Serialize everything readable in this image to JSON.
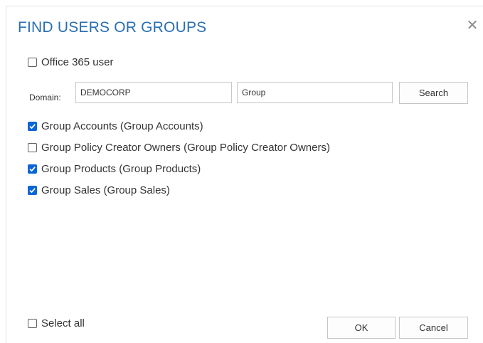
{
  "dialog": {
    "title": "FIND USERS OR GROUPS",
    "close_icon": "close-icon"
  },
  "office365": {
    "label": "Office 365 user",
    "checked": false
  },
  "domain": {
    "label": "Domain:",
    "value": "DEMOCORP",
    "search_value": "Group",
    "search_button": "Search"
  },
  "results": [
    {
      "label": "Group Accounts (Group Accounts)",
      "checked": true
    },
    {
      "label": "Group Policy Creator Owners (Group Policy Creator Owners)",
      "checked": false
    },
    {
      "label": "Group Products (Group Products)",
      "checked": true
    },
    {
      "label": "Group Sales (Group Sales)",
      "checked": true
    }
  ],
  "footer": {
    "select_all": "Select all",
    "ok": "OK",
    "cancel": "Cancel"
  },
  "colors": {
    "title": "#2a6eb3",
    "checked": "#0a66d8"
  }
}
